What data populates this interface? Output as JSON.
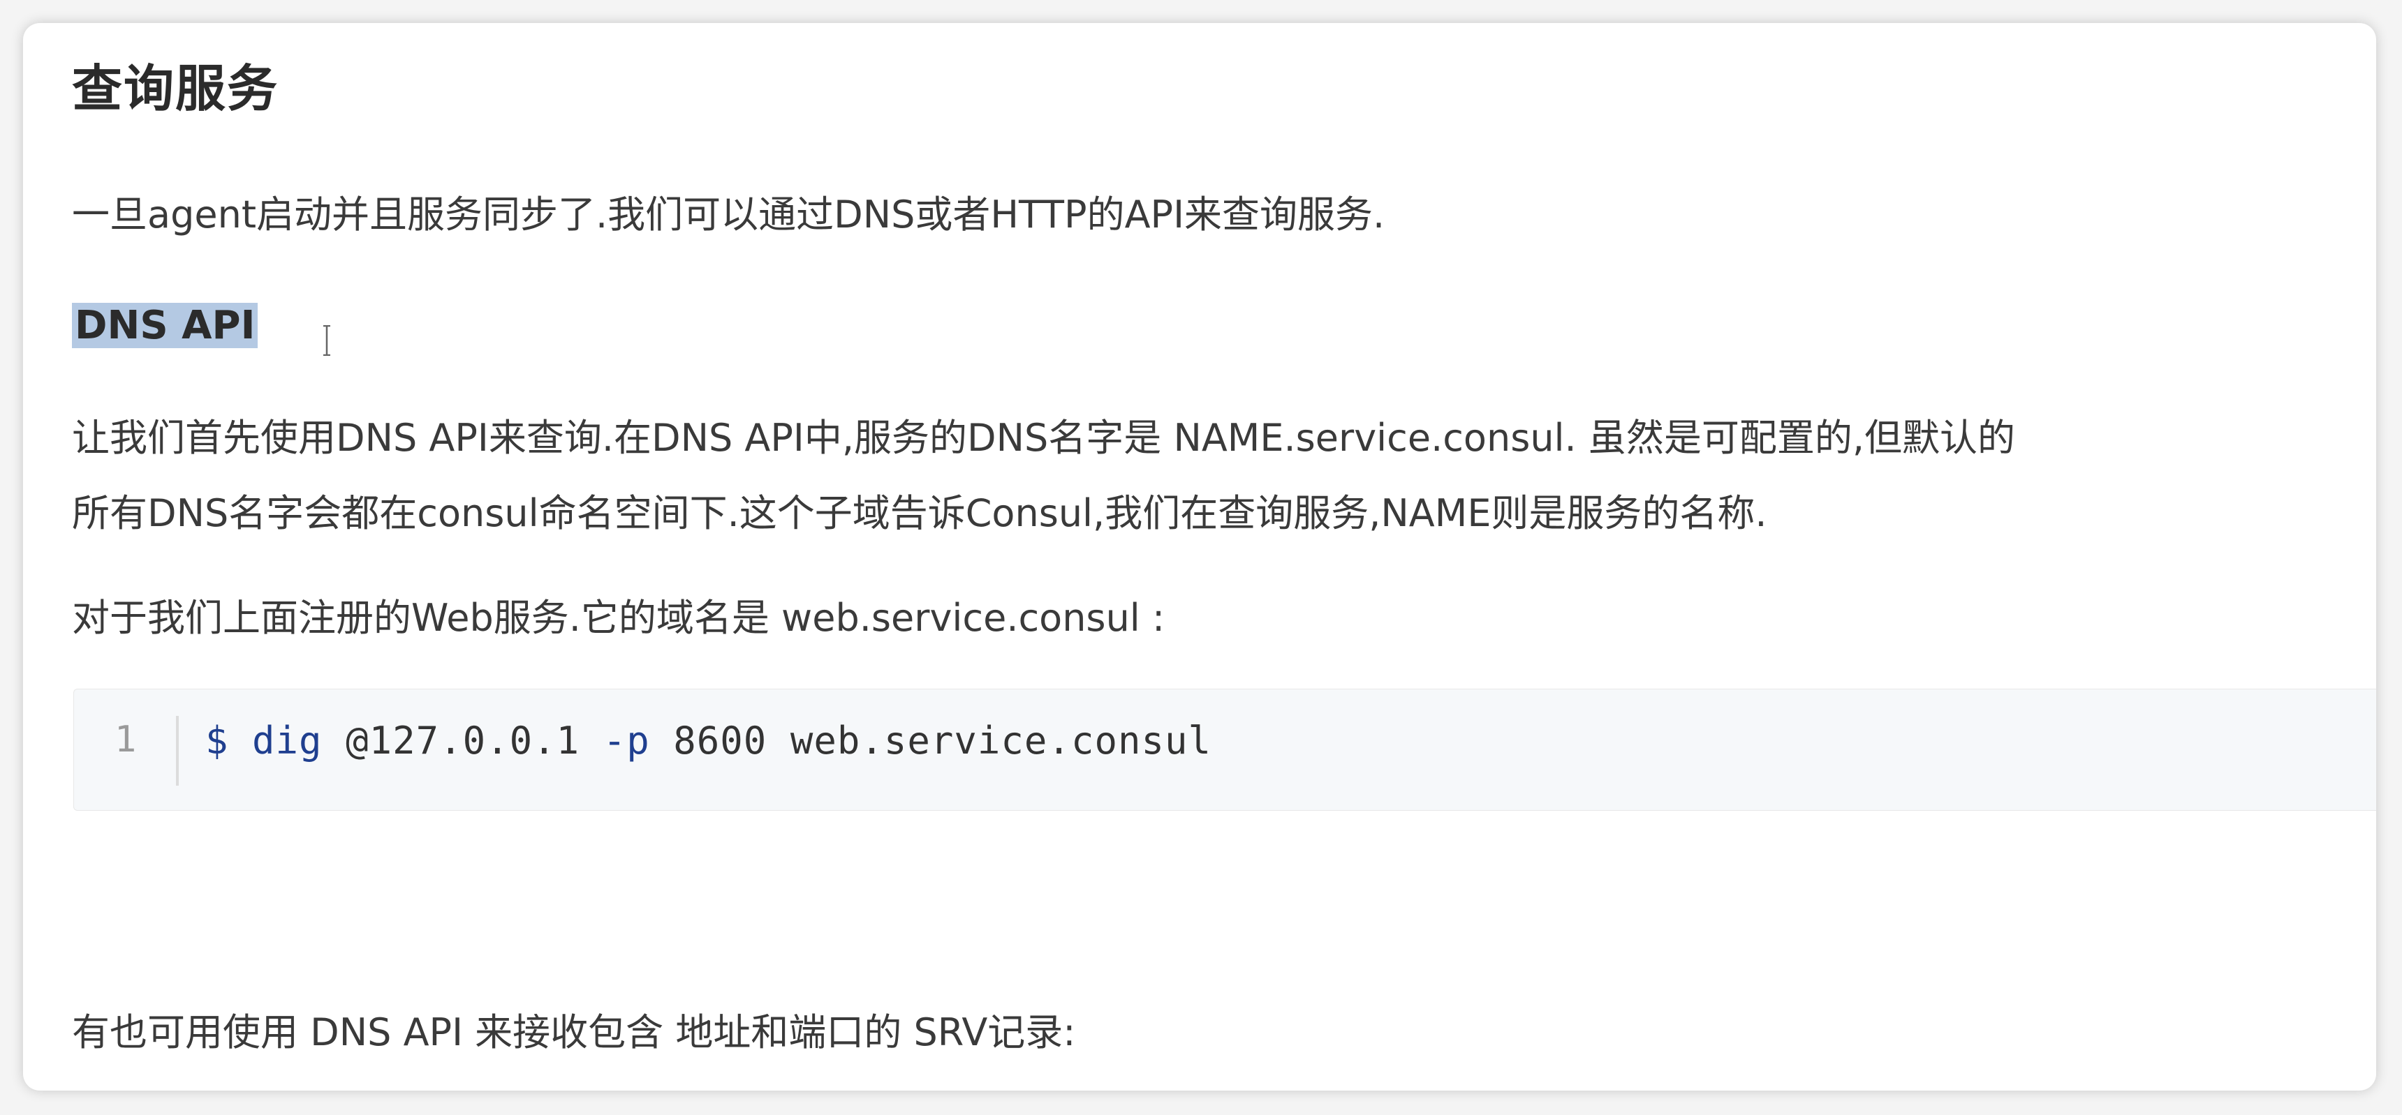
{
  "article": {
    "heading": "查询服务",
    "intro": "一旦agent启动并且服务同步了.我们可以通过DNS或者HTTP的API来查询服务.",
    "dns_api_heading": "DNS API",
    "dns_para_line1": "让我们首先使用DNS API来查询.在DNS API中,服务的DNS名字是 NAME.service.consul. 虽然是可配置的,但默认的",
    "dns_para_line2": "所有DNS名字会都在consul命名空间下.这个子域告诉Consul,我们在查询服务,NAME则是服务的名称.",
    "web_service_para": "对于我们上面注册的Web服务.它的域名是 web.service.consul :",
    "srv_para": "有也可用使用 DNS API 来接收包含 地址和端口的 SRV记录:"
  },
  "code_block": {
    "line_number": "1",
    "prompt": "$",
    "command": "dig",
    "address": " @127.0.0.1 ",
    "flag": "-p",
    "rest": " 8600 web.service.consul"
  },
  "colors": {
    "selection": "#b4c9e3",
    "code_background": "#f6f8fa",
    "code_keyword": "#1f3f8f"
  }
}
